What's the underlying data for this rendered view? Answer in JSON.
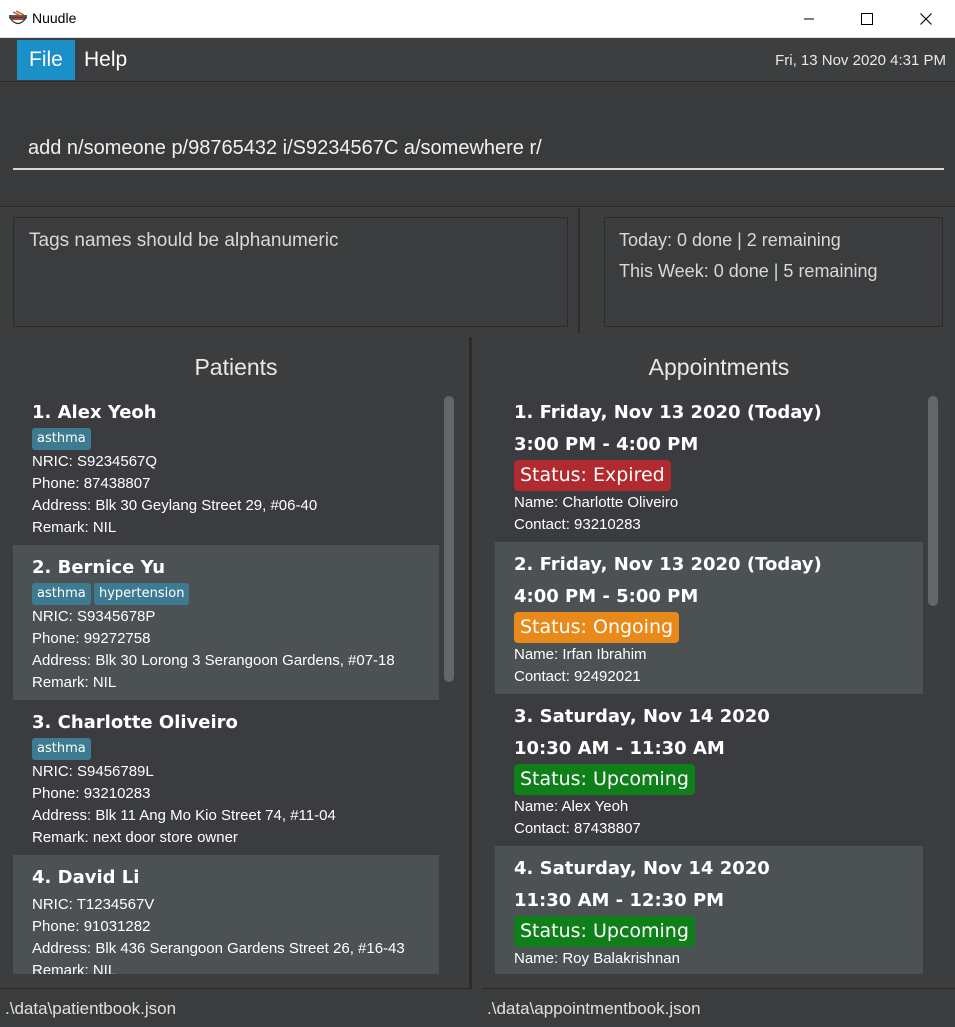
{
  "window": {
    "title": "Nuudle",
    "icon": "bowl-icon",
    "controls": [
      "minimize-icon",
      "maximize-icon",
      "close-icon"
    ]
  },
  "menu": {
    "file": "File",
    "help": "Help"
  },
  "datetime": "Fri, 13 Nov 2020 4:31 PM",
  "command": {
    "value": "add n/someone p/98765432 i/S9234567C a/somewhere r/"
  },
  "result": "Tags names should be alphanumeric",
  "stats": {
    "today": "Today: 0 done | 2 remaining",
    "week": "This Week: 0 done | 5 remaining"
  },
  "patients": {
    "title": "Patients",
    "items": [
      {
        "header": "1.  Alex Yeoh",
        "tags": [
          "asthma"
        ],
        "nric": "NRIC: S9234567Q",
        "phone": "Phone: 87438807",
        "address": "Address: Blk 30 Geylang Street 29, #06-40",
        "remark": "Remark: NIL"
      },
      {
        "header": "2.  Bernice Yu",
        "tags": [
          "asthma",
          "hypertension"
        ],
        "nric": "NRIC: S9345678P",
        "phone": "Phone: 99272758",
        "address": "Address: Blk 30 Lorong 3 Serangoon Gardens, #07-18",
        "remark": "Remark: NIL"
      },
      {
        "header": "3.  Charlotte Oliveiro",
        "tags": [
          "asthma"
        ],
        "nric": "NRIC: S9456789L",
        "phone": "Phone: 93210283",
        "address": "Address: Blk 11 Ang Mo Kio Street 74, #11-04",
        "remark": "Remark: next door store owner"
      },
      {
        "header": "4.  David Li",
        "tags": [],
        "nric": "NRIC: T1234567V",
        "phone": "Phone: 91031282",
        "address": "Address: Blk 436 Serangoon Gardens Street 26, #16-43",
        "remark": "Remark: NIL"
      }
    ]
  },
  "appointments": {
    "title": "Appointments",
    "items": [
      {
        "header": "1.  Friday, Nov 13 2020 (Today)",
        "time": "3:00 PM - 4:00 PM",
        "status": "Status: Expired",
        "status_color": "#b02a2f",
        "name": "Name: Charlotte Oliveiro",
        "contact": "Contact: 93210283"
      },
      {
        "header": "2.  Friday, Nov 13 2020 (Today)",
        "time": "4:00 PM - 5:00 PM",
        "status": "Status: Ongoing",
        "status_color": "#e8891a",
        "name": "Name: Irfan Ibrahim",
        "contact": "Contact: 92492021"
      },
      {
        "header": "3.  Saturday, Nov 14 2020",
        "time": "10:30 AM - 11:30 AM",
        "status": "Status: Upcoming",
        "status_color": "#0f7f1a",
        "name": "Name: Alex Yeoh",
        "contact": "Contact: 87438807"
      },
      {
        "header": "4.  Saturday, Nov 14 2020",
        "time": "11:30 AM - 12:30 PM",
        "status": "Status: Upcoming",
        "status_color": "#0f7f1a",
        "name": "Name: Roy Balakrishnan",
        "contact": ""
      }
    ]
  },
  "statusbar": {
    "patients_file": ".\\data\\patientbook.json",
    "appointments_file": ".\\data\\appointmentbook.json"
  }
}
